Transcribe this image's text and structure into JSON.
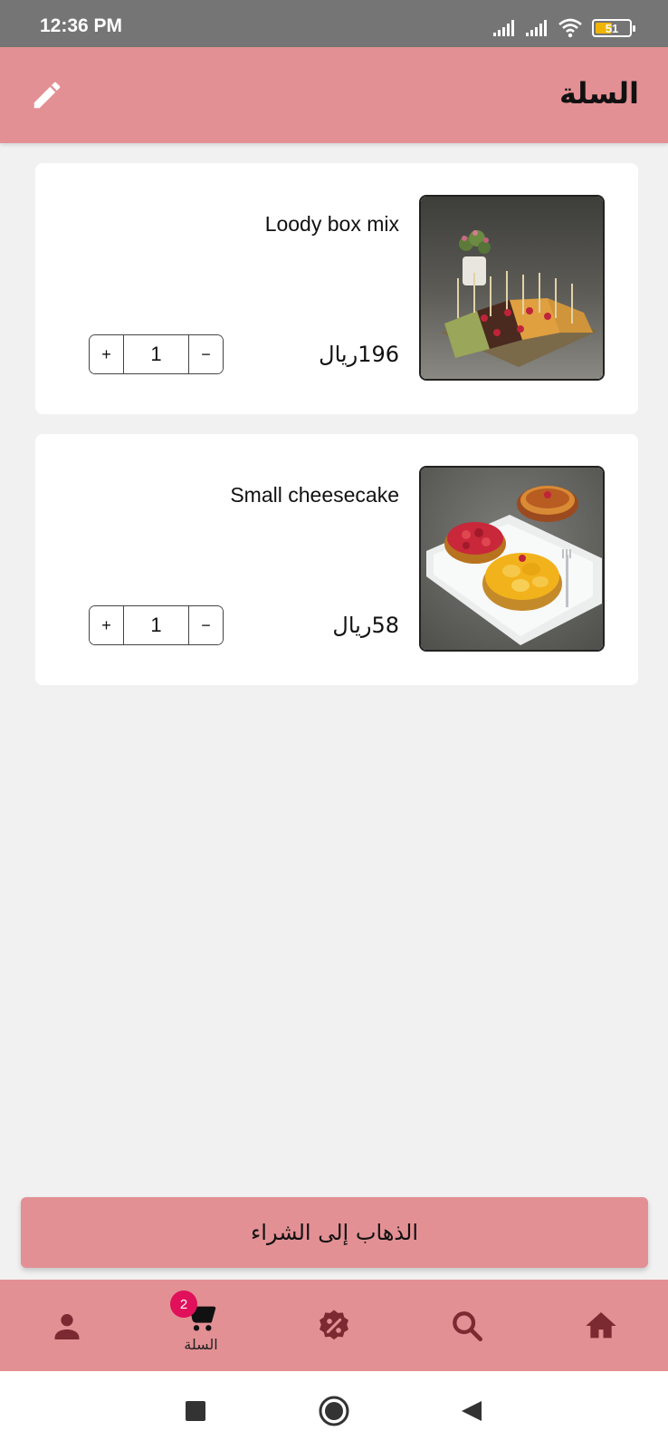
{
  "status_bar": {
    "time": "12:36 PM",
    "battery": "51"
  },
  "app_bar": {
    "title": "السلة",
    "edit_icon": "pencil-icon"
  },
  "cart": {
    "items": [
      {
        "name": "Loody box mix",
        "price": "196ريال",
        "quantity": "1",
        "image": "cake-box-photo"
      },
      {
        "name": "Small cheesecake",
        "price": "58ريال",
        "quantity": "1",
        "image": "cheesecake-photo"
      }
    ],
    "plus_label": "+",
    "minus_label": "−"
  },
  "checkout": {
    "label": "الذهاب إلى الشراء"
  },
  "bottom_nav": {
    "items": [
      {
        "icon": "person-icon",
        "label": ""
      },
      {
        "icon": "cart-icon",
        "label": "السلة",
        "badge": "2"
      },
      {
        "icon": "discount-icon",
        "label": ""
      },
      {
        "icon": "search-icon",
        "label": ""
      },
      {
        "icon": "home-icon",
        "label": ""
      }
    ]
  },
  "colors": {
    "accent": "#e39094",
    "badge": "#e0105a",
    "status_bar": "#757575",
    "background": "#f1f1f1"
  }
}
